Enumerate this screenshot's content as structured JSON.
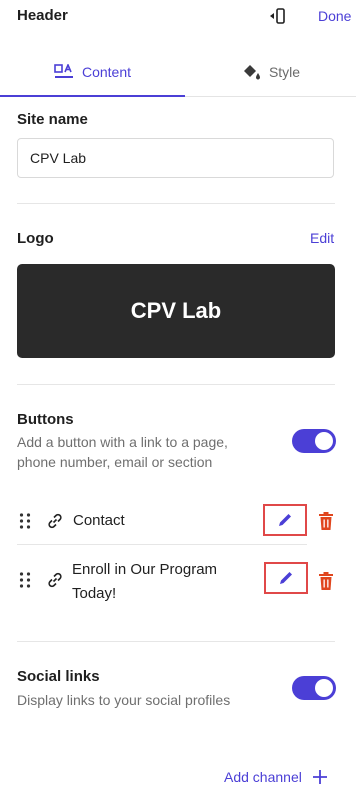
{
  "header": {
    "title": "Header",
    "done_label": "Done"
  },
  "tabs": [
    {
      "label": "Content",
      "icon": "content-layout-icon",
      "active": true
    },
    {
      "label": "Style",
      "icon": "paint-bucket-icon",
      "active": false
    }
  ],
  "site_name": {
    "label": "Site name",
    "value": "CPV Lab"
  },
  "logo": {
    "label": "Logo",
    "edit_label": "Edit",
    "preview_text": "CPV Lab"
  },
  "buttons": {
    "label": "Buttons",
    "description": "Add a button with a link to a page, phone number, email or section",
    "enabled": true,
    "items": [
      {
        "label": "Contact"
      },
      {
        "label": "Enroll in Our Program Today!"
      }
    ]
  },
  "social_links": {
    "label": "Social links",
    "description": "Display links to your social profiles",
    "enabled": true,
    "add_channel_label": "Add channel"
  },
  "colors": {
    "accent": "#4b3fd6",
    "delete": "#e0461e",
    "highlight": "#e04848",
    "logo_bg": "#2a2a2a"
  }
}
